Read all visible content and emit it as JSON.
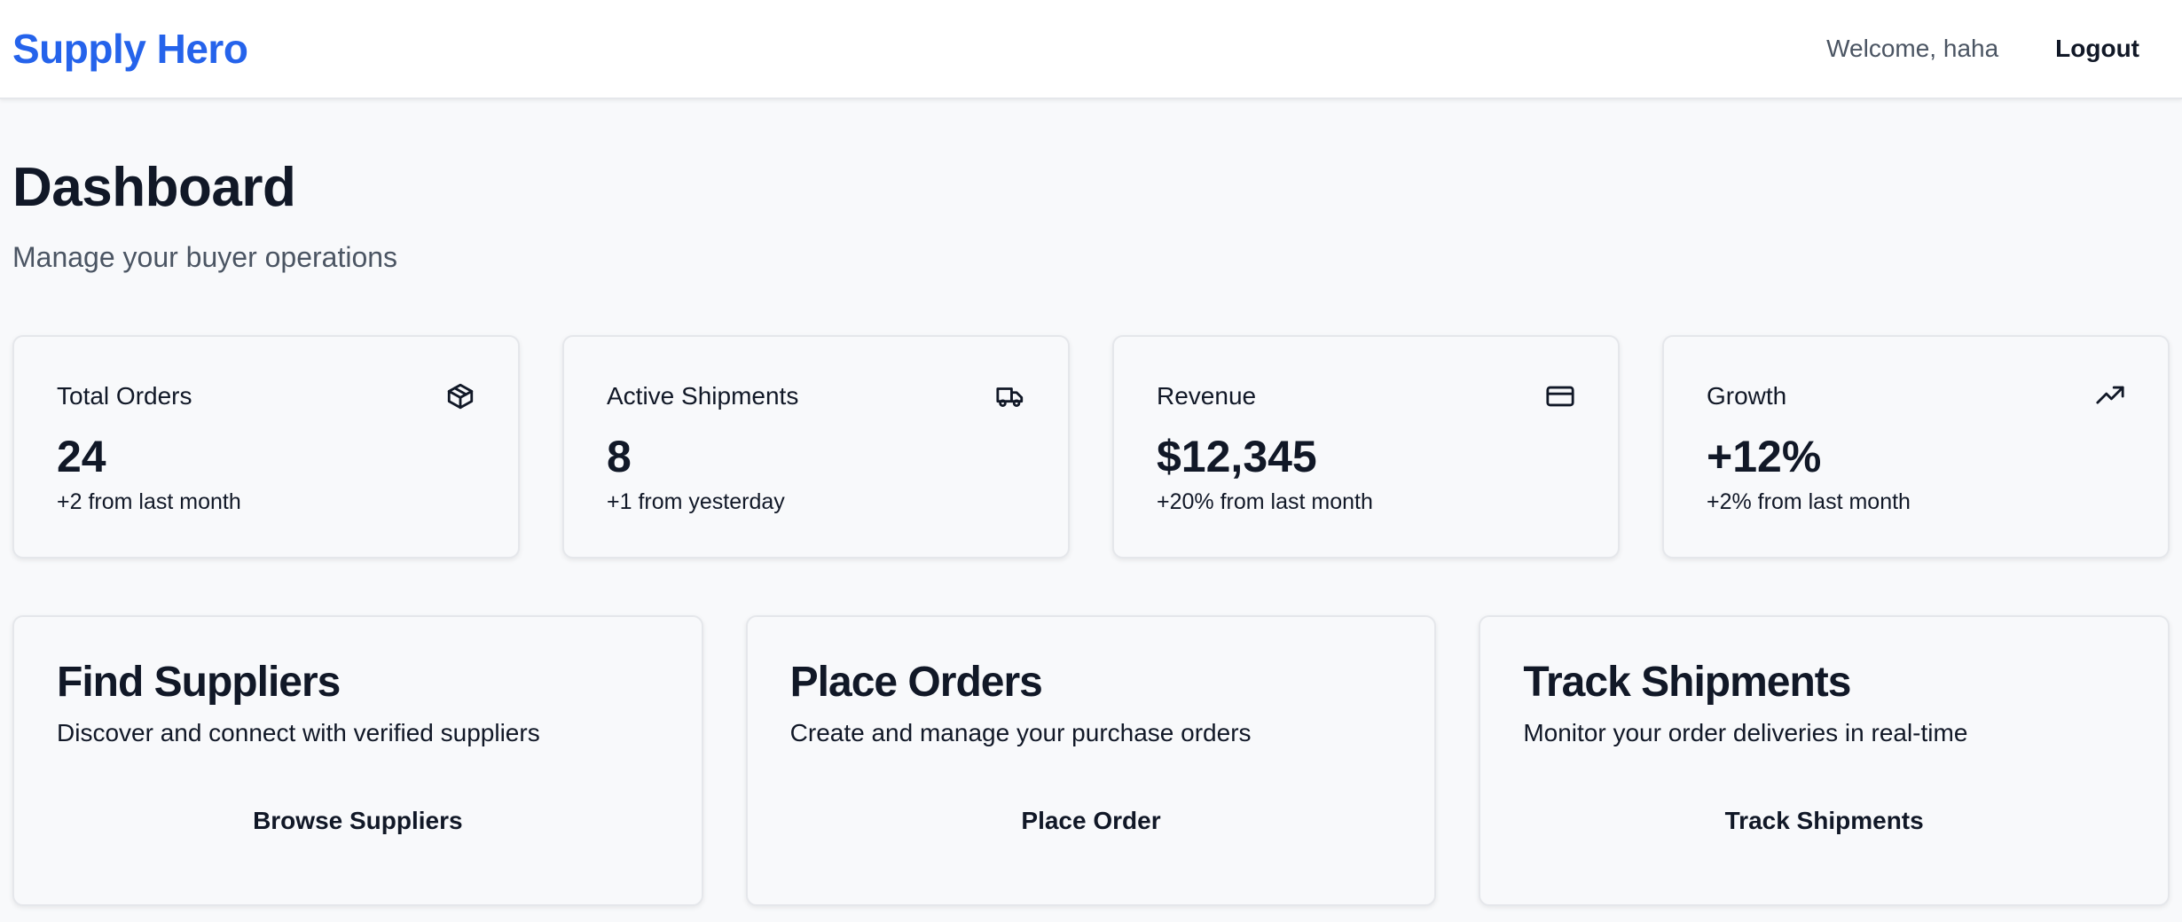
{
  "header": {
    "brand": "Supply Hero",
    "welcome": "Welcome, haha",
    "logout_label": "Logout",
    "brand_color": "#2563eb"
  },
  "page": {
    "title": "Dashboard",
    "subtitle": "Manage your buyer operations"
  },
  "stats": [
    {
      "label": "Total Orders",
      "value": "24",
      "change": "+2 from last month",
      "icon": "package-icon"
    },
    {
      "label": "Active Shipments",
      "value": "8",
      "change": "+1 from yesterday",
      "icon": "truck-icon"
    },
    {
      "label": "Revenue",
      "value": "$12,345",
      "change": "+20% from last month",
      "icon": "credit-card-icon"
    },
    {
      "label": "Growth",
      "value": "+12%",
      "change": "+2% from last month",
      "icon": "trending-up-icon"
    }
  ],
  "actions": [
    {
      "title": "Find Suppliers",
      "description": "Discover and connect with verified suppliers",
      "button": "Browse Suppliers"
    },
    {
      "title": "Place Orders",
      "description": "Create and manage your purchase orders",
      "button": "Place Order"
    },
    {
      "title": "Track Shipments",
      "description": "Monitor your order deliveries in real-time",
      "button": "Track Shipments"
    }
  ]
}
